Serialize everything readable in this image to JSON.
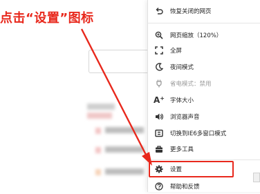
{
  "annotation": {
    "text": "点击“设置”图标"
  },
  "menu": {
    "items": [
      {
        "label": "恢复关闭的网页",
        "icon": "undo-icon",
        "disabled": false
      },
      {
        "label": "网页缩放（120%）",
        "icon": "zoom-icon",
        "disabled": false
      },
      {
        "label": "全屏",
        "icon": "fullscreen-icon",
        "disabled": false
      },
      {
        "label": "夜间模式",
        "icon": "moon-icon",
        "disabled": false
      },
      {
        "label": "省电模式：禁用",
        "icon": "power-plug-icon",
        "disabled": true
      },
      {
        "label": "字体大小",
        "icon": "font-size-icon",
        "disabled": false
      },
      {
        "label": "浏览器声音",
        "icon": "speaker-icon",
        "disabled": false
      },
      {
        "label": "切换到IE6多窗口模式",
        "icon": "window-switch-icon",
        "disabled": false
      },
      {
        "label": "更多工具",
        "icon": "toolbox-icon",
        "disabled": false
      },
      {
        "label": "设置",
        "icon": "gear-icon",
        "disabled": false
      },
      {
        "label": "帮助和反馈",
        "icon": "help-icon",
        "disabled": false
      }
    ]
  },
  "colors": {
    "accent_red": "#e8281c",
    "disabled_text": "#9b9b9b",
    "text": "#222222"
  }
}
